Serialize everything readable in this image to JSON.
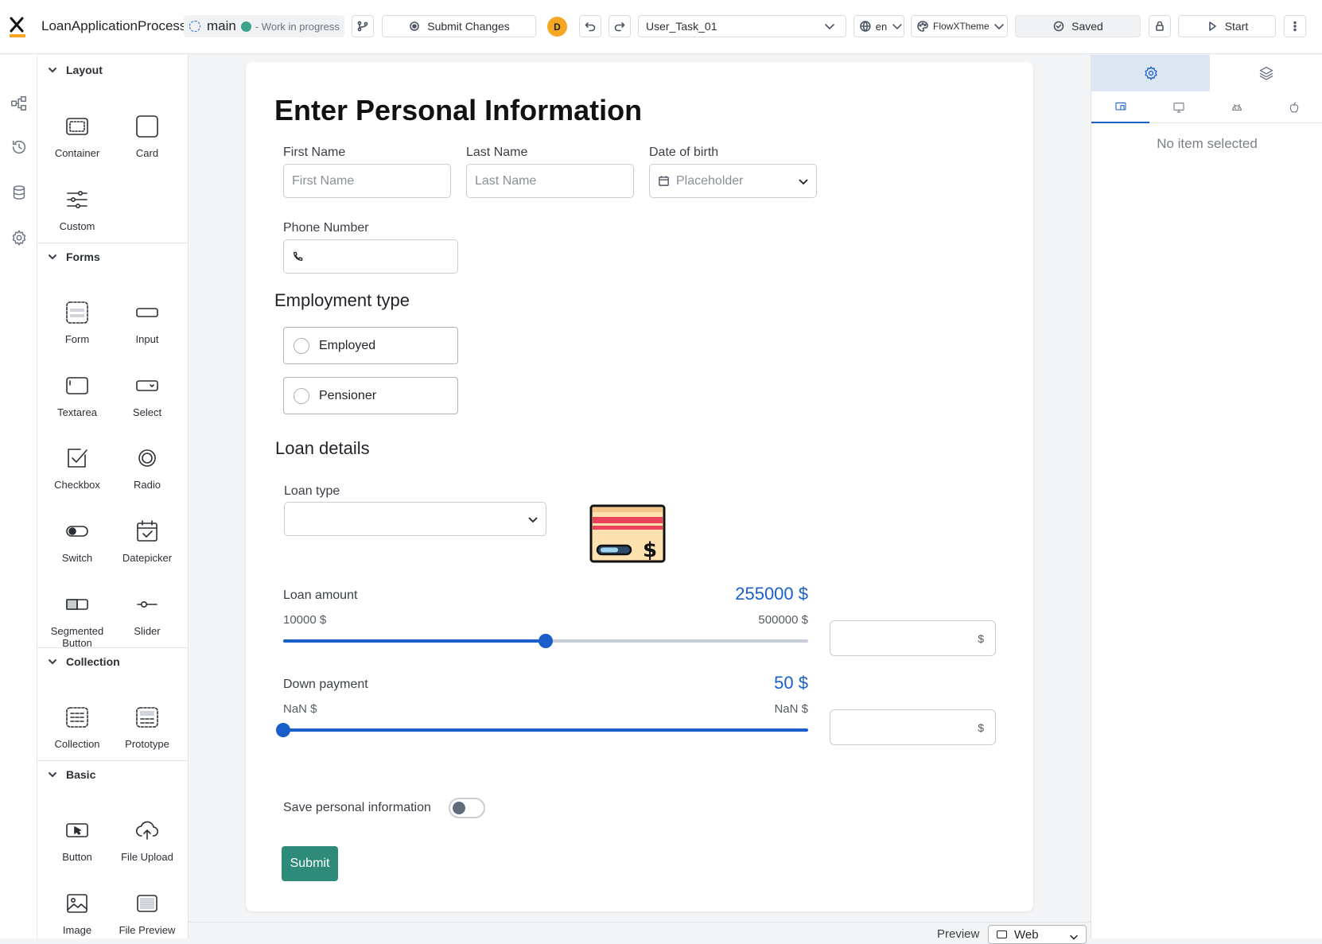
{
  "topbar": {
    "process_name": "LoanApplicationProcess",
    "branch": "main",
    "status": "- Work in progress",
    "submit_label": "Submit Changes",
    "avatar_initial": "D",
    "task_selected": "User_Task_01",
    "language": "en",
    "theme": "FlowXTheme",
    "saved_label": "Saved",
    "start_label": "Start"
  },
  "palette": {
    "sections": {
      "layout": "Layout",
      "forms": "Forms",
      "collection": "Collection",
      "basic": "Basic"
    },
    "items": {
      "container": "Container",
      "card": "Card",
      "custom": "Custom",
      "form": "Form",
      "input": "Input",
      "textarea": "Textarea",
      "select": "Select",
      "checkbox": "Checkbox",
      "radio": "Radio",
      "switch": "Switch",
      "datepicker": "Datepicker",
      "segmented_line1": "Segmented",
      "segmented_line2": "Button",
      "slider": "Slider",
      "collection": "Collection",
      "prototype": "Prototype",
      "button": "Button",
      "file_upload": "File Upload",
      "image": "Image",
      "file_preview": "File Preview"
    }
  },
  "form": {
    "title": "Enter Personal Information",
    "first_name": {
      "label": "First Name",
      "placeholder": "First Name"
    },
    "last_name": {
      "label": "Last Name",
      "placeholder": "Last Name"
    },
    "dob": {
      "label": "Date of birth",
      "placeholder": "Placeholder"
    },
    "phone": {
      "label": "Phone Number"
    },
    "employment": {
      "heading": "Employment type",
      "options": [
        "Employed",
        "Pensioner"
      ]
    },
    "loan": {
      "heading": "Loan details",
      "type_label": "Loan type"
    },
    "loan_amount": {
      "label": "Loan amount",
      "value_text": "255000 $",
      "min_text": "10000 $",
      "max_text": "500000 $",
      "fraction": 0.5,
      "unit": "$"
    },
    "down_payment": {
      "label": "Down payment",
      "value_text": "50 $",
      "min_text": "NaN $",
      "max_text": "NaN $",
      "fraction": 0.0,
      "unit": "$"
    },
    "save_toggle_label": "Save personal information",
    "submit_label": "Submit"
  },
  "bottom": {
    "preview_label": "Preview",
    "platform": "Web"
  },
  "right_panel": {
    "empty_text": "No item selected"
  },
  "colors": {
    "accent_blue": "#1a5fc9",
    "submit_green": "#2e8b7a",
    "logo_orange": "#f5a623"
  }
}
